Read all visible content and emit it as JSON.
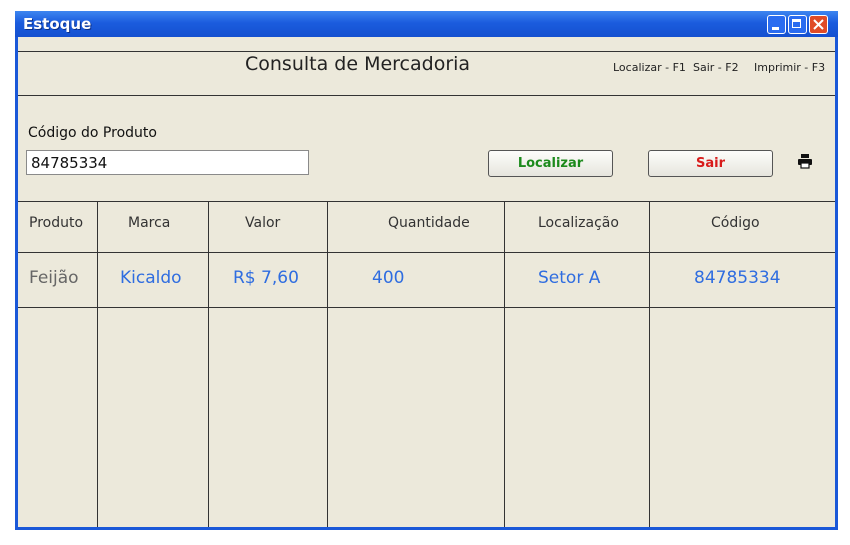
{
  "window": {
    "title": "Estoque"
  },
  "header": {
    "title": "Consulta de Mercadoria",
    "shortcuts": [
      "Localizar - F1",
      "Sair - F2",
      "Imprimir - F3"
    ]
  },
  "form": {
    "code_label": "Código do Produto",
    "code_value": "84785334",
    "localizar_label": "Localizar",
    "sair_label": "Sair"
  },
  "table": {
    "columns": [
      "Produto",
      "Marca",
      "Valor",
      "Quantidade",
      "Localização",
      "Código"
    ],
    "rows": [
      [
        "Feijão",
        "Kicaldo",
        "R$ 7,60",
        "400",
        "Setor A",
        "84785334"
      ]
    ]
  },
  "icons": [
    "minimize-icon",
    "maximize-icon",
    "close-icon",
    "printer-icon"
  ],
  "colors": {
    "titlebar": "#1b5cde",
    "close": "#e04b27",
    "localizar": "#1c8a1c",
    "sair": "#d81b1b",
    "cell_text": "#2f6de0"
  }
}
